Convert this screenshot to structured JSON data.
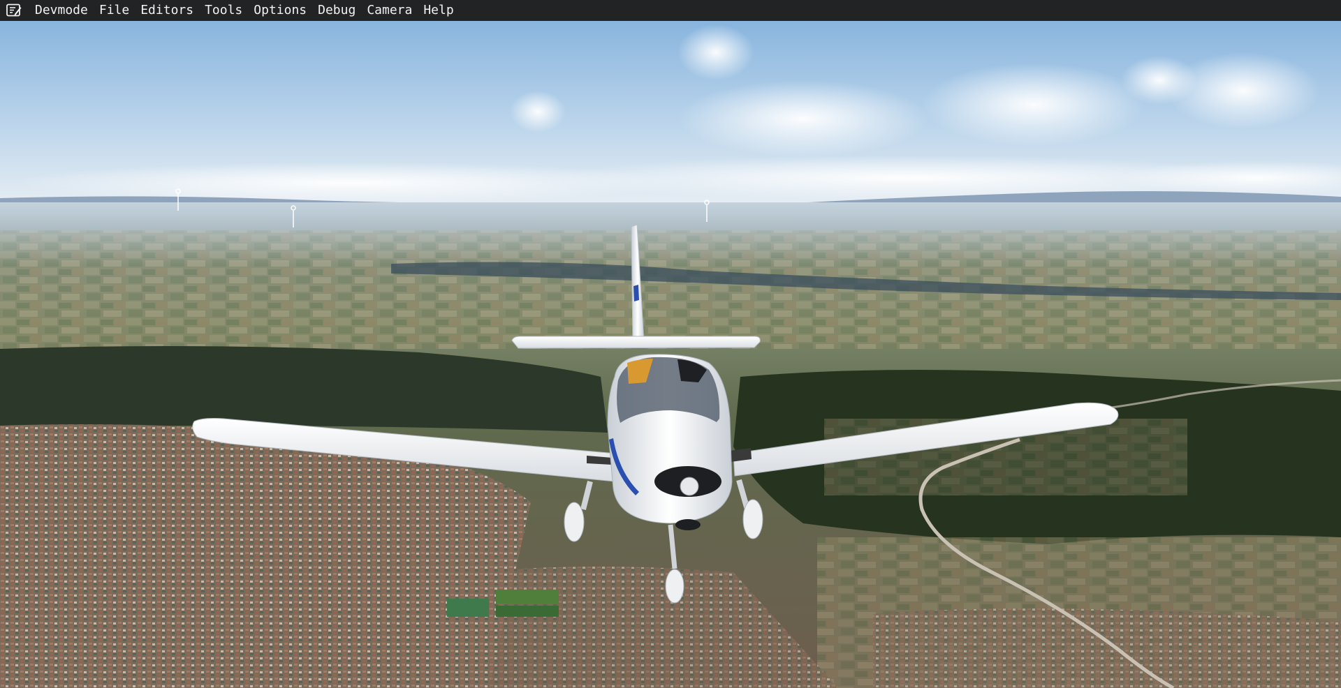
{
  "menubar": {
    "logo_icon": "devmode-notepad-icon",
    "items": [
      {
        "label": "Devmode"
      },
      {
        "label": "File"
      },
      {
        "label": "Editors"
      },
      {
        "label": "Tools"
      },
      {
        "label": "Options"
      },
      {
        "label": "Debug"
      },
      {
        "label": "Camera"
      },
      {
        "label": "Help"
      }
    ]
  },
  "scene": {
    "description_icon": "aircraft-chase-view",
    "colors": {
      "sky_top": "#86b6e2",
      "sky_horizon": "#e4ecf2",
      "terrain_far": "#8fa3b4",
      "forest": "#2d3a2a",
      "aircraft_white": "#f4f6f8",
      "stripe_blue": "#2a4fb0",
      "menubar_bg": "#222325"
    }
  }
}
